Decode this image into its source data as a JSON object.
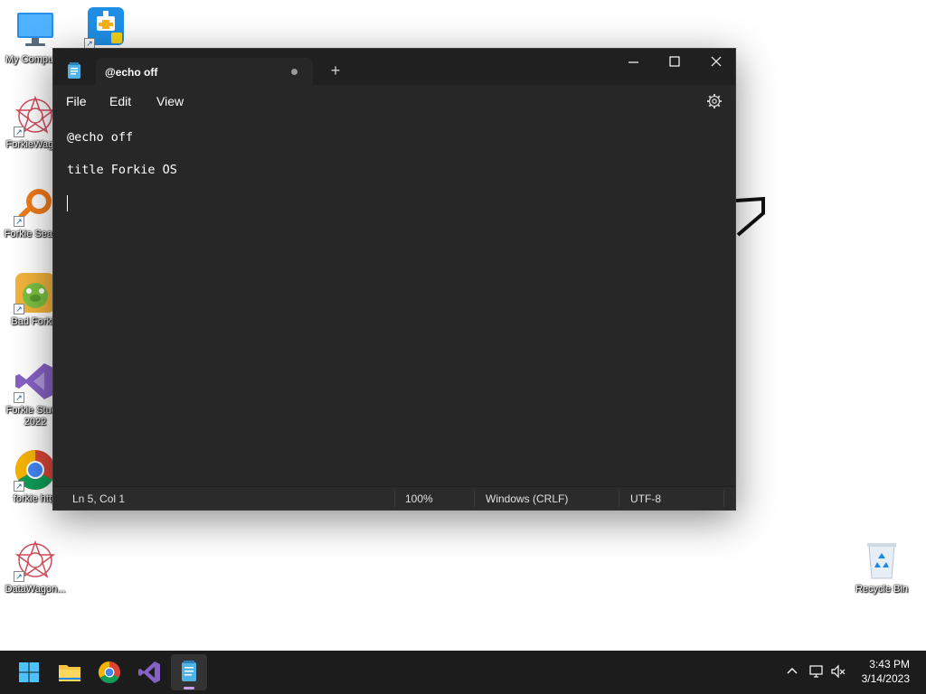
{
  "desktop": {
    "icons": [
      {
        "label": "My Computer",
        "name": "my-computer"
      },
      {
        "label": "ForkieWagon",
        "name": "forkiewagon"
      },
      {
        "label": "Forkie Search",
        "name": "forkie-search"
      },
      {
        "label": "Bad Forkie",
        "name": "bad-forkie"
      },
      {
        "label": "Forkie Studio 2022",
        "label_line1": "Forkie Studio",
        "label_line2": "2022",
        "name": "forkie-studio"
      },
      {
        "label": "forkie http",
        "name": "forkie-http"
      },
      {
        "label": "DataWagon...",
        "name": "datawagon"
      },
      {
        "label": "Recycle Bin",
        "name": "recycle-bin"
      }
    ]
  },
  "notepad": {
    "tab_title": "@echo off",
    "new_tab_symbol": "+",
    "menu": {
      "file": "File",
      "edit": "Edit",
      "view": "View"
    },
    "lines": [
      "@echo off",
      "",
      "title Forkie OS",
      "",
      ""
    ],
    "status": {
      "position": "Ln 5, Col 1",
      "zoom": "100%",
      "line_endings": "Windows (CRLF)",
      "encoding": "UTF-8"
    },
    "colors": {
      "background": "#272727",
      "titlebar": "#202020",
      "text": "#ffffff"
    }
  },
  "taskbar": {
    "apps": [
      "start-icon",
      "file-explorer-icon",
      "chrome-icon",
      "visual-studio-icon",
      "notepad-icon"
    ],
    "active_app": "notepad",
    "clock": {
      "time": "3:43 PM",
      "date": "3/14/2023"
    },
    "indicator_color": "#c89cf0"
  }
}
